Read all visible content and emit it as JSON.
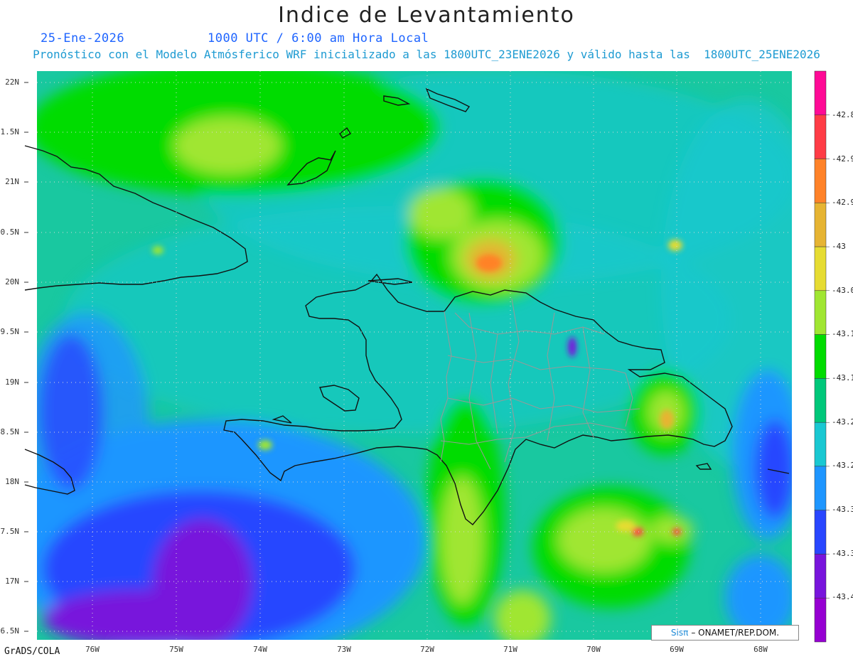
{
  "header": {
    "title": "Indice de Levantamiento",
    "date": "25-Ene-2026",
    "time": "1000 UTC / 6:00 am Hora Local",
    "subtitle": "Pronóstico con el Modelo Atmósferico WRF inicializado a las 1800UTC_23ENE2026 y válido hasta las  1800UTC_25ENE2026"
  },
  "map": {
    "lat_labels": [
      "22N",
      "1.5N",
      "21N",
      "0.5N",
      "20N",
      "9.5N",
      "19N",
      "8.5N",
      "18N",
      "7.5N",
      "17N",
      "6.5N"
    ],
    "lon_labels": [
      "76W",
      "75W",
      "74W",
      "73W",
      "72W",
      "71W",
      "70W",
      "69W",
      "68W"
    ],
    "lat_range": [
      16.5,
      22
    ],
    "lon_range": [
      -76.7,
      -67.6
    ],
    "dominant_field_color": "#19c8a0"
  },
  "colorbar": {
    "colors": [
      "#ff0a96",
      "#ff3c46",
      "#ff8228",
      "#e6b432",
      "#e6dc32",
      "#a0e632",
      "#00dc00",
      "#00c87a",
      "#19c8d2",
      "#1e96ff",
      "#2846ff",
      "#7814dc",
      "#9600d2"
    ],
    "labels": [
      "-42.8",
      "-42.9",
      "-42.9",
      "-43",
      "-43.0",
      "-43.1",
      "-43.1",
      "-43.2",
      "-43.2",
      "-43.3",
      "-43.3",
      "-43.4"
    ]
  },
  "footer": {
    "text": "GrADS/COLA"
  },
  "credit": {
    "sis": "Sisπ",
    "text": "– ONAMET/REP.DOM."
  }
}
